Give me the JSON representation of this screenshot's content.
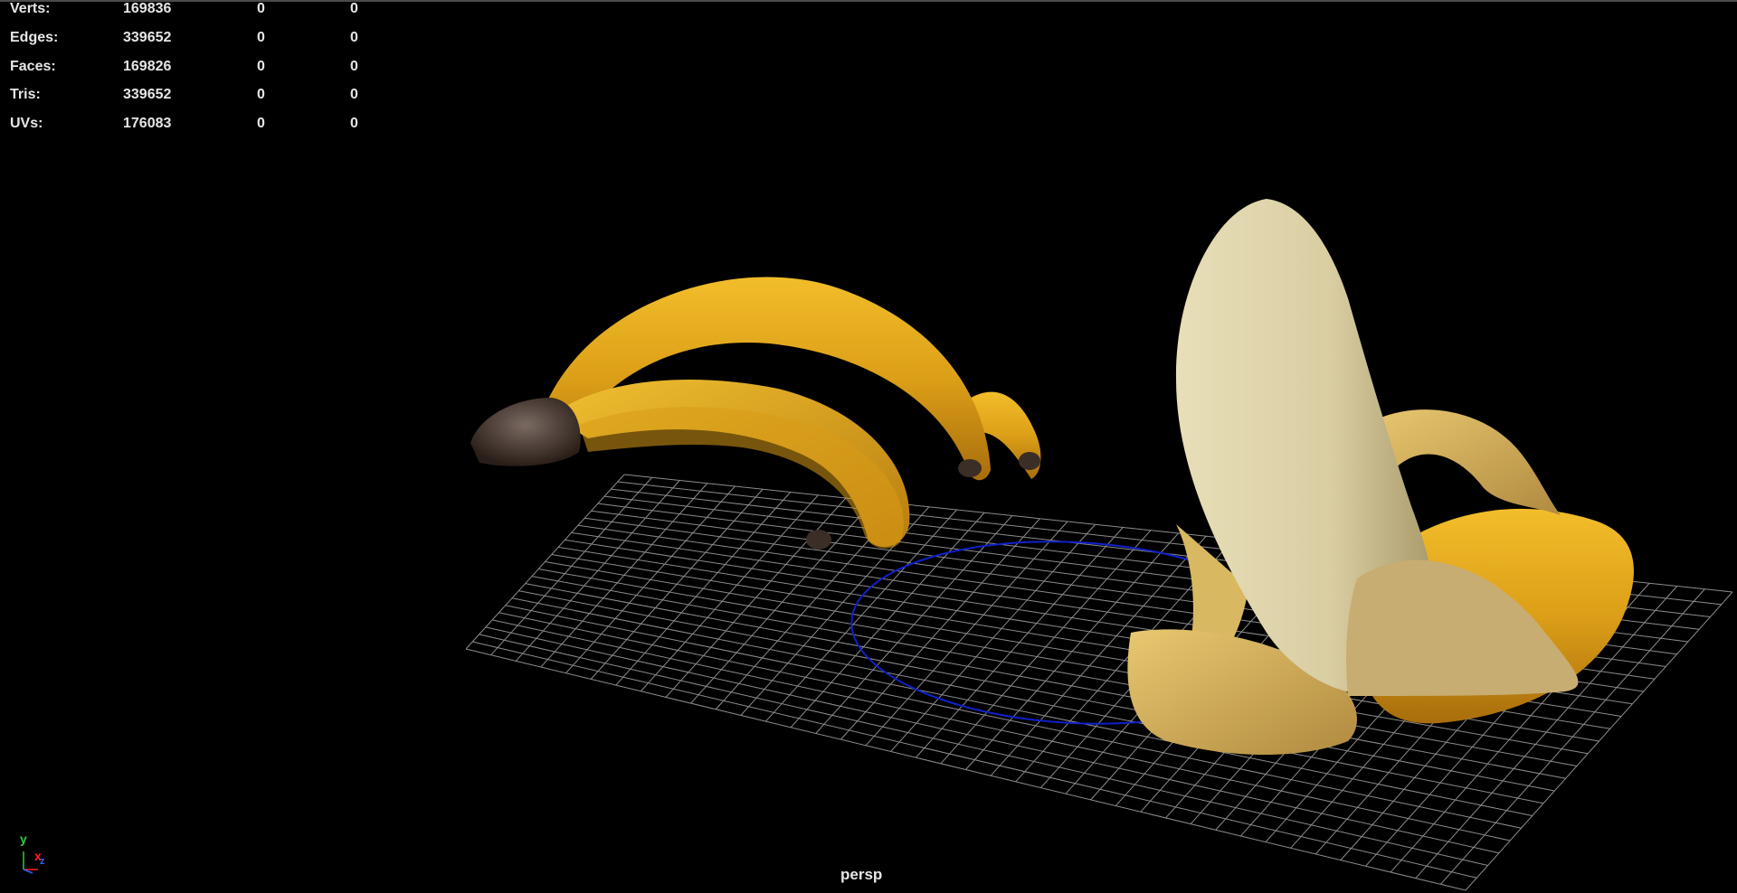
{
  "hud": {
    "rows": [
      {
        "label": "Verts:",
        "values": [
          "169836",
          "0",
          "0"
        ]
      },
      {
        "label": "Edges:",
        "values": [
          "339652",
          "0",
          "0"
        ]
      },
      {
        "label": "Faces:",
        "values": [
          "169826",
          "0",
          "0"
        ]
      },
      {
        "label": "Tris:",
        "values": [
          "339652",
          "0",
          "0"
        ]
      },
      {
        "label": "UVs:",
        "values": [
          "176083",
          "0",
          "0"
        ]
      }
    ]
  },
  "viewport": {
    "camera_label": "persp"
  },
  "axis_gizmo": {
    "y_label": "y",
    "x_label": "x",
    "z_label": "z",
    "y_color": "#2ecc40",
    "x_color": "#ff2020",
    "z_color": "#3060ff"
  },
  "colors": {
    "background": "#000000",
    "grid": "#9a9a9a",
    "selection_circle": "#1020c8",
    "banana_yellow": "#e0a520",
    "banana_flesh": "#ddd3a8"
  },
  "icons": [
    "axis-gizmo-icon"
  ]
}
